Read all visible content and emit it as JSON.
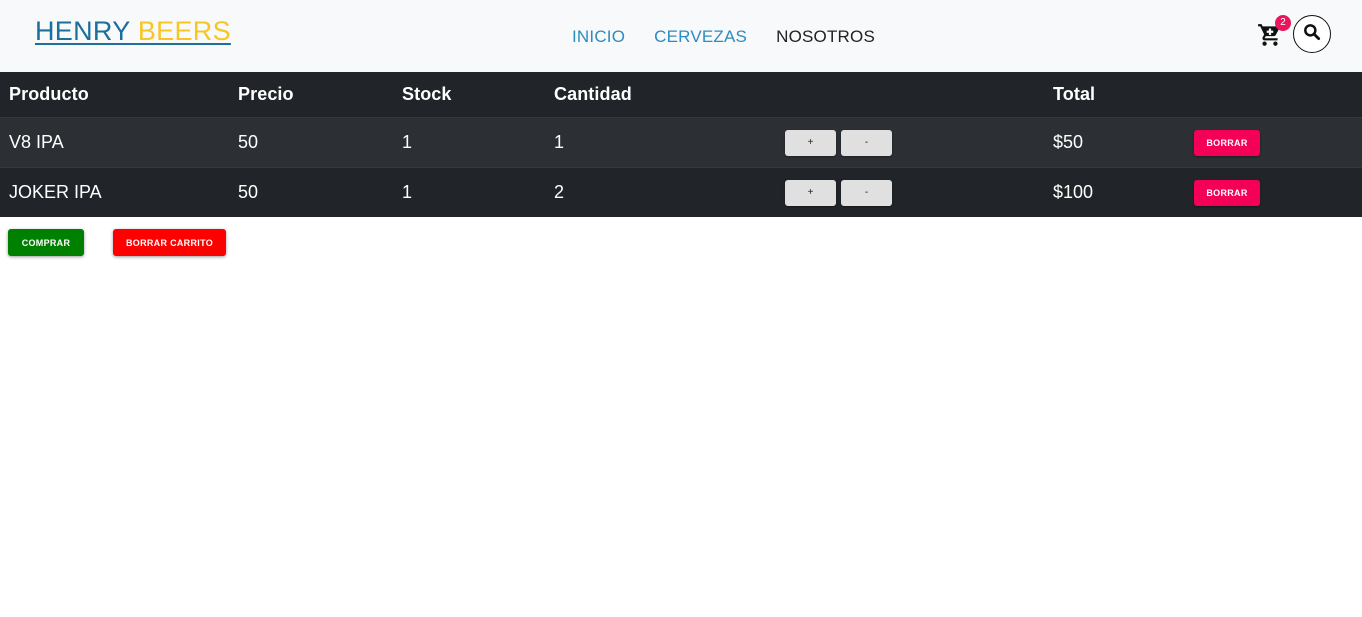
{
  "navbar": {
    "brand_part1": "HENRY",
    "brand_part2": "BEERS",
    "links": [
      "INICIO",
      "CERVEZAS",
      "NOSOTROS"
    ],
    "cart_icon": "shopping-cart-icon",
    "cart_count": "2",
    "search_icon": "search-icon"
  },
  "table": {
    "headers": {
      "product": "Producto",
      "price": "Precio",
      "stock": "Stock",
      "quantity": "Cantidad",
      "total": "Total"
    },
    "rows": [
      {
        "product": "V8 IPA",
        "price": "50",
        "stock": "1",
        "quantity": "1",
        "plus": "+",
        "minus": "-",
        "total": "$50",
        "delete": "BORRAR"
      },
      {
        "product": "JOKER IPA",
        "price": "50",
        "stock": "1",
        "quantity": "2",
        "plus": "+",
        "minus": "-",
        "total": "$100",
        "delete": "BORRAR"
      }
    ]
  },
  "actions": {
    "buy": "COMPRAR",
    "clear_cart": "BORRAR CARRITO"
  },
  "colors": {
    "brand_blue": "#1b6f9c",
    "brand_yellow": "#f7c623",
    "table_bg": "#212529",
    "delete_pink": "#f50057",
    "buy_green": "#008000",
    "clear_red": "#ff0000"
  }
}
